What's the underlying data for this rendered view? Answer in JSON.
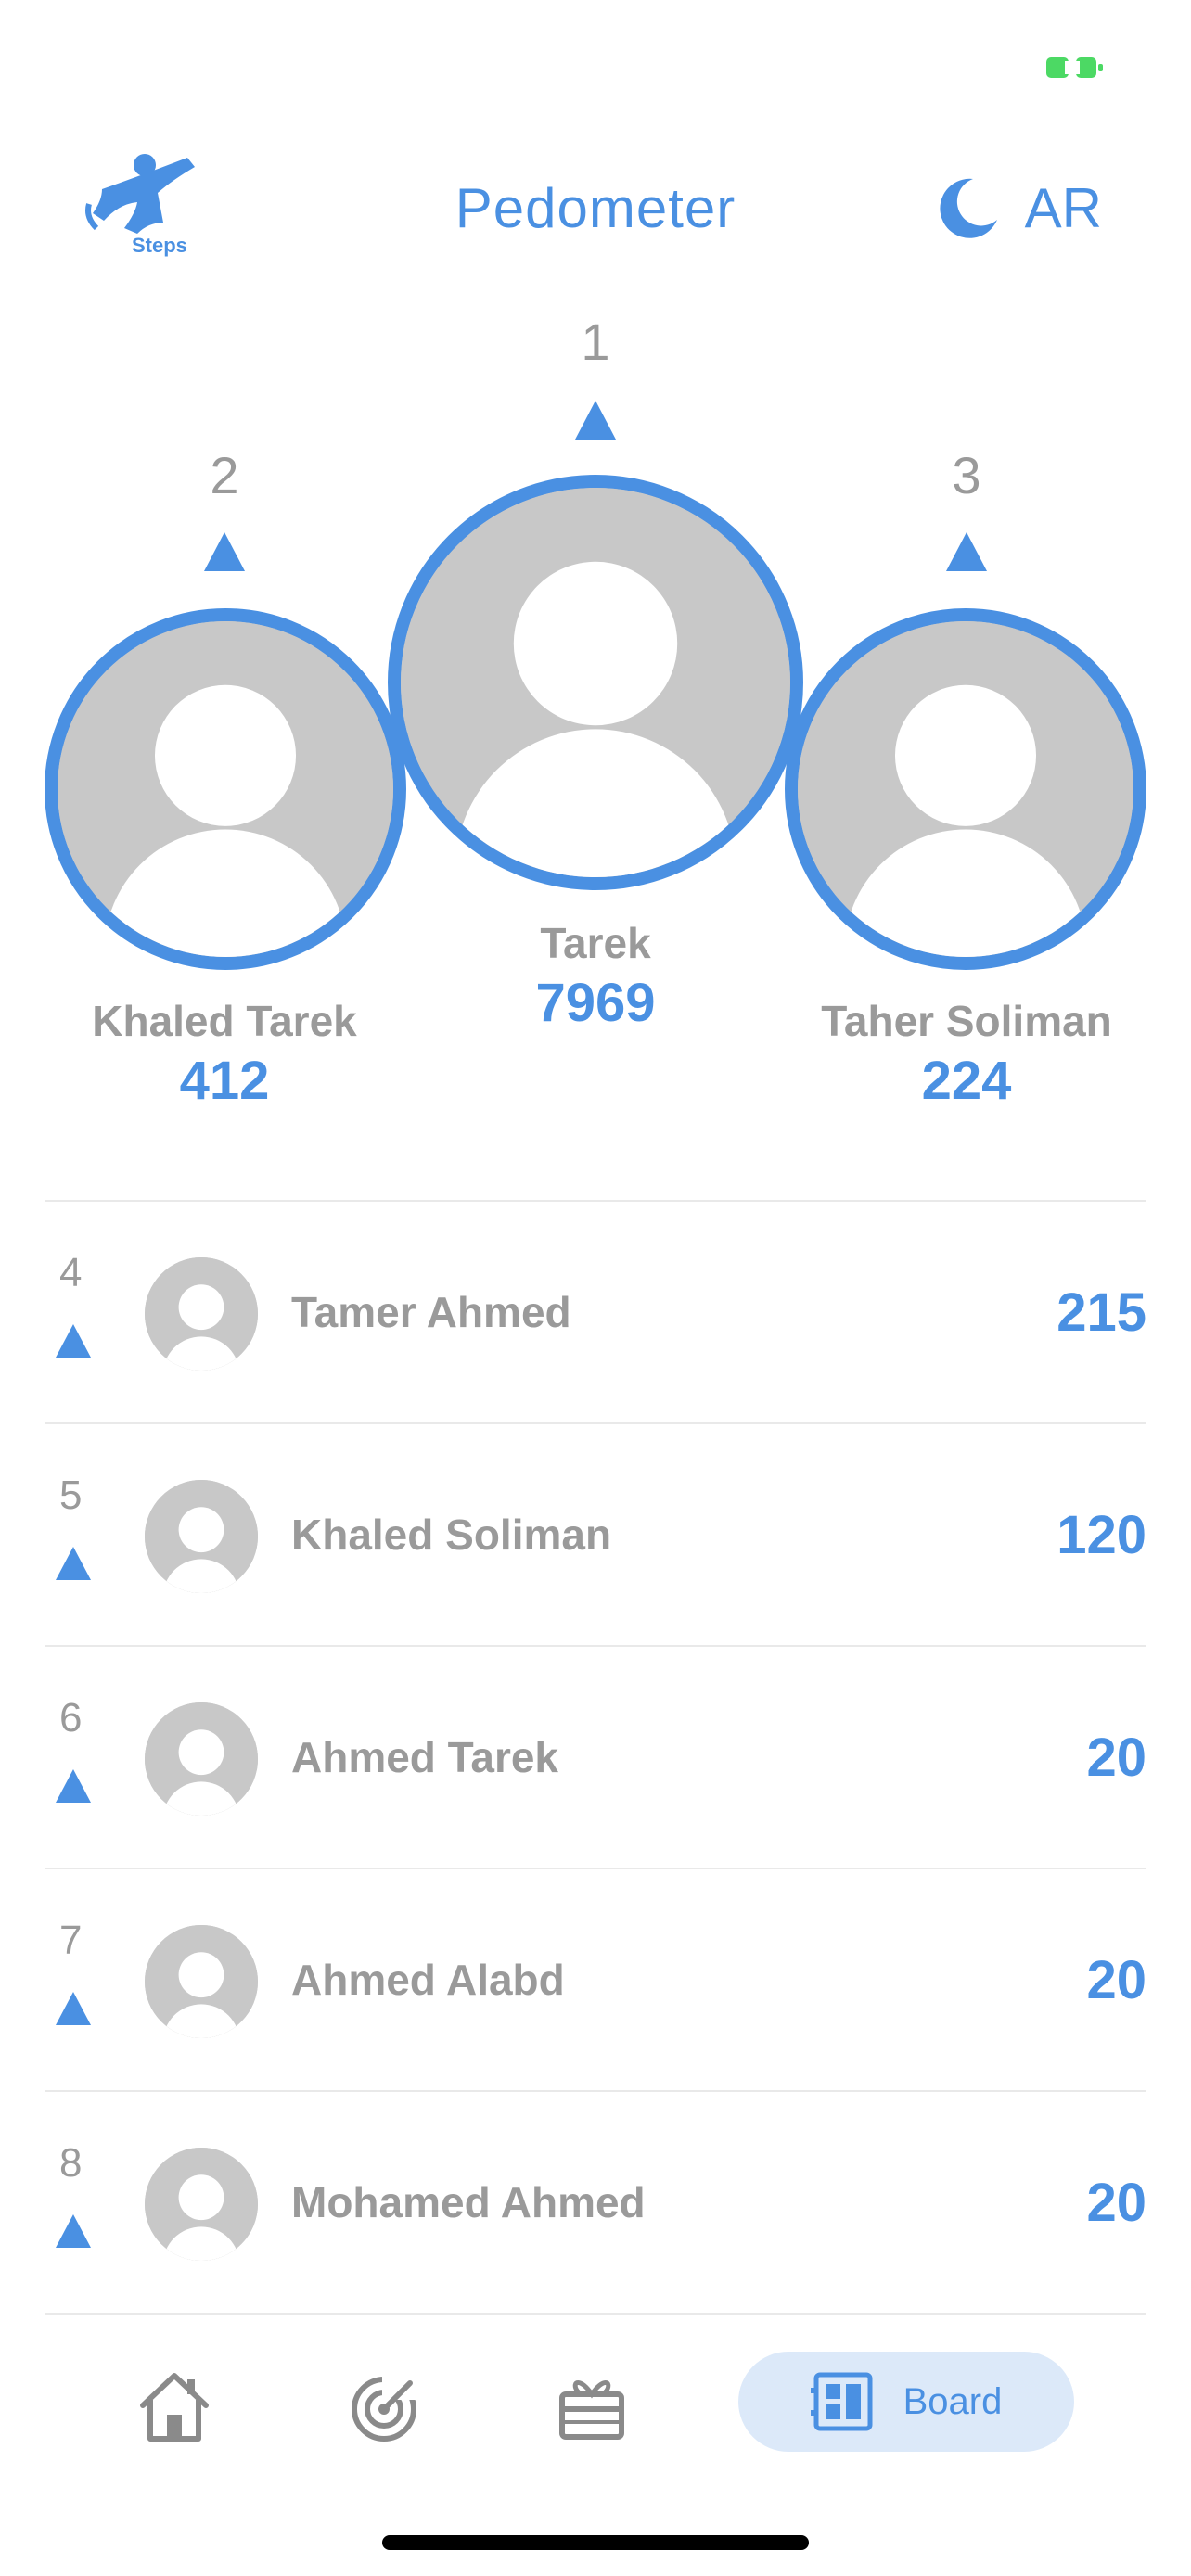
{
  "header": {
    "logo_text": "Steps",
    "title": "Pedometer",
    "language_toggle": "AR",
    "theme_icon": "moon-icon",
    "accent_color": "#4a90e2"
  },
  "podium": {
    "first": {
      "rank": "1",
      "name": "Tarek",
      "score": "7969"
    },
    "second": {
      "rank": "2",
      "name": "Khaled Tarek",
      "score": "412"
    },
    "third": {
      "rank": "3",
      "name": "Taher Soliman",
      "score": "224"
    }
  },
  "leaderboard": [
    {
      "rank": "4",
      "name": "Tamer Ahmed",
      "score": "215"
    },
    {
      "rank": "5",
      "name": "Khaled Soliman",
      "score": "120"
    },
    {
      "rank": "6",
      "name": "Ahmed Tarek",
      "score": "20"
    },
    {
      "rank": "7",
      "name": "Ahmed Alabd",
      "score": "20"
    },
    {
      "rank": "8",
      "name": "Mohamed Ahmed",
      "score": "20"
    }
  ],
  "bottom_nav": {
    "items": [
      {
        "icon": "home-icon"
      },
      {
        "icon": "target-icon"
      },
      {
        "icon": "gift-icon"
      },
      {
        "icon": "board-icon",
        "label": "Board",
        "active": true
      }
    ]
  }
}
